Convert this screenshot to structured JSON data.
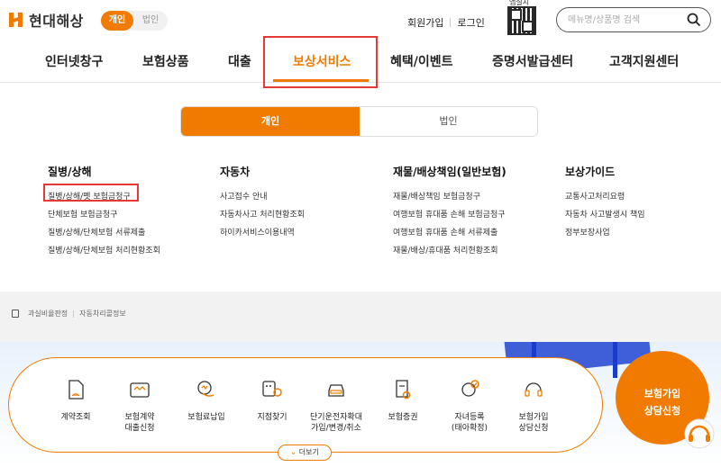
{
  "header": {
    "logo_text": "현대해상",
    "segment": {
      "personal": "개인",
      "corporate": "법인"
    },
    "links": {
      "signup": "회원가입",
      "login": "로그인"
    },
    "qr_label": "앱설치",
    "search_placeholder": "메뉴명/상품명 검색"
  },
  "gnb": {
    "items": [
      "인터넷창구",
      "보험상품",
      "대출",
      "보상서비스",
      "혜택/이벤트",
      "증명서발급센터",
      "고객지원센터"
    ]
  },
  "tabs": {
    "personal": "개인",
    "corporate": "법인"
  },
  "columns": [
    {
      "title": "질병/상해",
      "items": [
        "질병/상해/펫 보험금청구",
        "단체보험 보험금청구",
        "질병/상해/단체보험 서류제출",
        "질병/상해/단체보험 처리현황조회"
      ]
    },
    {
      "title": "자동차",
      "items": [
        "사고접수 안내",
        "자동차사고 처리현황조회",
        "하이카서비스이용내역"
      ]
    },
    {
      "title": "재물/배상책임(일반보험)",
      "items": [
        "재물/배상책임 보험금청구",
        "여행보험 휴대품 손해 보험금청구",
        "여행보험 휴대품 손해 서류제출",
        "재물/배상/휴대품 처리현황조회"
      ]
    },
    {
      "title": "보상가이드",
      "items": [
        "교통사고처리요령",
        "자동차 사고발생시 책임",
        "정부보장사업"
      ]
    }
  ],
  "breadcrumb": [
    "과실비율판정",
    "자동차리콜정보"
  ],
  "quick_menu": [
    {
      "label": "계약조회",
      "icon": "document-search-icon"
    },
    {
      "label": "보험계약\n대출신청",
      "icon": "wallet-icon"
    },
    {
      "label": "보험료납입",
      "icon": "coin-hand-icon"
    },
    {
      "label": "지점찾기",
      "icon": "map-pin-icon"
    },
    {
      "label": "단기운전자확대\n가입/변경/취소",
      "icon": "car-icon"
    },
    {
      "label": "보험증권",
      "icon": "certificate-icon"
    },
    {
      "label": "자녀등록\n(태아확정)",
      "icon": "baby-icon"
    },
    {
      "label": "보험가입\n상담신청",
      "icon": "headset-icon"
    }
  ],
  "more_label": "더보기",
  "consult": {
    "line1": "보험가입",
    "line2": "상담신청"
  },
  "colors": {
    "accent": "#f07b00",
    "highlight": "#e53935"
  }
}
